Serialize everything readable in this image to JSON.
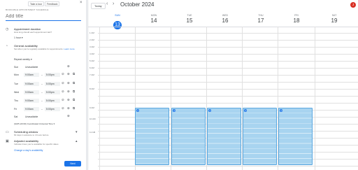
{
  "panel": {
    "tabs": [
      "Take a tour",
      "Feedback"
    ],
    "header_sub": "BOOKABLE APPOINTMENT SCHEDULE",
    "title_placeholder": "Add title",
    "appointment_duration": {
      "title": "Appointment duration",
      "sub": "How long should each appointment last?",
      "value": "1 hour"
    },
    "general_availability": {
      "title": "General availability",
      "sub": "Set when you're regularly available for appointments.",
      "learn_more": "Learn more"
    },
    "repeat": "Repeat weekly",
    "days": [
      {
        "day": "Sun",
        "unavailable": "Unavailable"
      },
      {
        "day": "Mon",
        "start": "9:00am",
        "end": "5:00pm"
      },
      {
        "day": "Tue",
        "start": "9:00am",
        "end": "5:00pm"
      },
      {
        "day": "Wed",
        "start": "9:00am",
        "end": "5:00pm"
      },
      {
        "day": "Thu",
        "start": "9:00am",
        "end": "5:00pm"
      },
      {
        "day": "Fri",
        "start": "9:00am",
        "end": "5:00pm"
      },
      {
        "day": "Sat",
        "unavailable": "Unavailable"
      }
    ],
    "timezone": "(GMT+00:00) Coordinated Universal Time",
    "scheduling_window": {
      "title": "Scheduling window",
      "sub": "60 days in advance to 4 hours before"
    },
    "adjusted_availability": {
      "title": "Adjusted availability",
      "sub": "Indicate times you're available for specific dates",
      "link": "Change a day's availability"
    },
    "next_label": "Next"
  },
  "calendar": {
    "today_label": "Today",
    "month": "October 2024",
    "avatar_letter": "J",
    "columns": [
      {
        "dow": "SUN",
        "num": "13",
        "today": true
      },
      {
        "dow": "MON",
        "num": "14"
      },
      {
        "dow": "TUE",
        "num": "15"
      },
      {
        "dow": "WED",
        "num": "16"
      },
      {
        "dow": "THU",
        "num": "17"
      },
      {
        "dow": "FRI",
        "num": "18"
      },
      {
        "dow": "SAT",
        "num": "19"
      }
    ],
    "time_labels": [
      "1 AM",
      "2 AM",
      "3 AM",
      "4 AM",
      "5 AM",
      "6 AM",
      "7 AM",
      "8 AM",
      "9 AM",
      "10 AM",
      "11 AM"
    ]
  },
  "colors": {
    "accent": "#1a73e8",
    "block": "#a8d4f0",
    "avatar": "#d93025"
  }
}
